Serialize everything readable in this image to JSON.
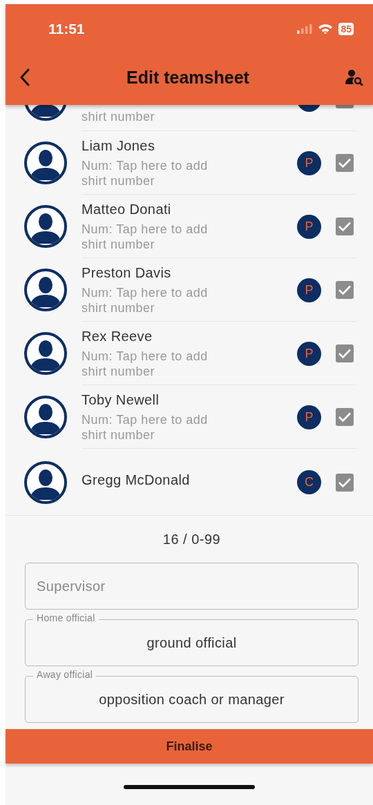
{
  "status_bar": {
    "time": "11:51",
    "battery": "85"
  },
  "header": {
    "title": "Edit teamsheet"
  },
  "players": [
    {
      "number_hint": "shirt number",
      "checked": true
    },
    {
      "name": "Liam Jones",
      "number_hint": "Num: Tap here to add shirt number",
      "role": "P",
      "checked": true
    },
    {
      "name": "Matteo Donati",
      "number_hint": "Num: Tap here to add shirt number",
      "role": "P",
      "checked": true
    },
    {
      "name": "Preston Davis",
      "number_hint": "Num: Tap here to add shirt number",
      "role": "P",
      "checked": true
    },
    {
      "name": "Rex Reeve",
      "number_hint": "Num: Tap here to add shirt number",
      "role": "P",
      "checked": true
    },
    {
      "name": "Toby Newell",
      "number_hint": "Num: Tap here to add shirt number",
      "role": "P",
      "checked": true
    },
    {
      "name": "Gregg McDonald",
      "role": "C",
      "checked": true
    }
  ],
  "count": "16 / 0-99",
  "fields": [
    {
      "placeholder": "Supervisor"
    },
    {
      "label": "Home official",
      "value": "ground official"
    },
    {
      "label": "Away official",
      "value": "opposition coach or manager"
    }
  ],
  "finalise_button": "Finalise"
}
